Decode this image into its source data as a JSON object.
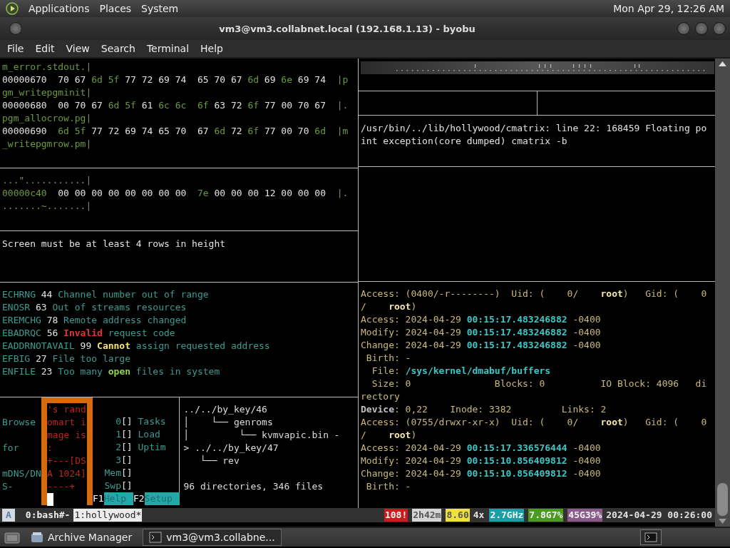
{
  "top_panel": {
    "menus": [
      "Applications",
      "Places",
      "System"
    ],
    "clock": "Mon Apr 29, 12:26 AM"
  },
  "window": {
    "title": "vm3@vm3.collabnet.local (192.168.1.13) - byobu"
  },
  "menu_bar": [
    "File",
    "Edit",
    "View",
    "Search",
    "Terminal",
    "Help"
  ],
  "terminal": {
    "left_column": [
      {
        "kind": "text",
        "lines": [
          {
            "segments": [
              {
                "kind": "hex",
                "text": "m_error.stdout."
              },
              {
                "kind": "dim",
                "text": "|"
              }
            ]
          },
          {
            "segments": [
              {
                "kind": "plain",
                "text": "00000670  70 67 "
              },
              {
                "kind": "hex",
                "text": "6d 5f"
              },
              {
                "kind": "plain",
                "text": " 77 72 69 74  65 70 67 "
              },
              {
                "kind": "hex",
                "text": "6d"
              },
              {
                "kind": "plain",
                "text": " 69 "
              },
              {
                "kind": "hex",
                "text": "6e"
              },
              {
                "kind": "plain",
                "text": " 69 74  "
              },
              {
                "kind": "dim",
                "text": "|"
              },
              {
                "kind": "hex",
                "text": "p"
              }
            ]
          },
          {
            "segments": [
              {
                "kind": "hex",
                "text": "gm_writepgminit"
              },
              {
                "kind": "dim",
                "text": "|"
              }
            ]
          },
          {
            "segments": [
              {
                "kind": "plain",
                "text": "00000680  00 70 67 "
              },
              {
                "kind": "hex",
                "text": "6d 5f"
              },
              {
                "kind": "plain",
                "text": " 61 "
              },
              {
                "kind": "hex",
                "text": "6c 6c  6f"
              },
              {
                "kind": "plain",
                "text": " 63 72 "
              },
              {
                "kind": "hex",
                "text": "6f"
              },
              {
                "kind": "plain",
                "text": " 77 00 70 67  "
              },
              {
                "kind": "dim",
                "text": "|."
              }
            ]
          },
          {
            "segments": [
              {
                "kind": "hex",
                "text": "pgm_allocrow.pg"
              },
              {
                "kind": "dim",
                "text": "|"
              }
            ]
          },
          {
            "segments": [
              {
                "kind": "plain",
                "text": "00000690  "
              },
              {
                "kind": "hex",
                "text": "6d 5f"
              },
              {
                "kind": "plain",
                "text": " 77 72 69 74 65 70  67 "
              },
              {
                "kind": "hex",
                "text": "6d"
              },
              {
                "kind": "plain",
                "text": " 72 "
              },
              {
                "kind": "hex",
                "text": "6f"
              },
              {
                "kind": "plain",
                "text": " 77 00 70 "
              },
              {
                "kind": "hex",
                "text": "6d"
              },
              {
                "kind": "dim",
                "text": "  |"
              },
              {
                "kind": "hex",
                "text": "m"
              }
            ]
          },
          {
            "segments": [
              {
                "kind": "hex",
                "text": "_writepgmrow.pm"
              },
              {
                "kind": "dim",
                "text": "|"
              }
            ]
          }
        ]
      },
      {
        "kind": "text",
        "lines": [
          {
            "segments": [
              {
                "kind": "dim",
                "text": "...\"...........|"
              }
            ]
          },
          {
            "segments": [
              {
                "kind": "hex",
                "text": "00000c40"
              },
              {
                "kind": "plain",
                "text": "  00 00 00 00 00 00 00 00  "
              },
              {
                "kind": "hex",
                "text": "7e"
              },
              {
                "kind": "plain",
                "text": " 00 00 00 12 00 00 00  "
              },
              {
                "kind": "dim",
                "text": "|."
              }
            ]
          },
          {
            "segments": [
              {
                "kind": "dim",
                "text": ".......~.......|"
              }
            ]
          }
        ]
      },
      {
        "kind": "text",
        "lines": [
          {
            "segments": [
              {
                "kind": "plain",
                "text": "Screen must be at least 4 rows in height"
              }
            ]
          }
        ]
      },
      {
        "kind": "text",
        "lines": [
          {
            "segments": [
              {
                "kind": "info",
                "text": "ECHRNG "
              },
              {
                "kind": "plain",
                "text": "44"
              },
              {
                "kind": "info",
                "text": " Channel number out of range"
              }
            ]
          },
          {
            "segments": [
              {
                "kind": "info",
                "text": "ENOSR "
              },
              {
                "kind": "plain",
                "text": "63"
              },
              {
                "kind": "info",
                "text": " Out of streams resources"
              }
            ]
          },
          {
            "segments": [
              {
                "kind": "info",
                "text": "EREMCHG "
              },
              {
                "kind": "plain",
                "text": "78"
              },
              {
                "kind": "info",
                "text": " Remote address changed"
              }
            ]
          },
          {
            "segments": [
              {
                "kind": "info",
                "text": "EBADRQC "
              },
              {
                "kind": "plain",
                "text": "56 "
              },
              {
                "kind": "alert",
                "text": "Invalid"
              },
              {
                "kind": "info",
                "text": " request code"
              }
            ]
          },
          {
            "segments": [
              {
                "kind": "info",
                "text": "EADDRNOTAVAIL "
              },
              {
                "kind": "plain",
                "text": "99 "
              },
              {
                "kind": "warn",
                "text": "Cannot"
              },
              {
                "kind": "info",
                "text": " assign requested address"
              }
            ]
          },
          {
            "segments": [
              {
                "kind": "info",
                "text": "EFBIG "
              },
              {
                "kind": "plain",
                "text": "27"
              },
              {
                "kind": "info",
                "text": " File too large"
              }
            ]
          },
          {
            "segments": [
              {
                "kind": "info",
                "text": "ENFILE "
              },
              {
                "kind": "plain",
                "text": "23"
              },
              {
                "kind": "info",
                "text": " Too many "
              },
              {
                "kind": "ok",
                "text": "open"
              },
              {
                "kind": "info",
                "text": " files in system"
              }
            ]
          }
        ]
      },
      {
        "kind": "split",
        "halves": [
          {
            "kind": "monitor",
            "rows": [
              {
                "box": "'s rand"
              },
              {
                "left": "Browse",
                "box": "omart i",
                "index": "0",
                "meter": "[]",
                "label": "Tasks"
              },
              {
                "box": "mage is",
                "index": "1",
                "meter": "[]",
                "label": "Load"
              },
              {
                "left": "for",
                "box": ":",
                "index": "2",
                "meter": "[]",
                "label": "Uptim"
              },
              {
                "box": "+---[DS",
                "index": "3",
                "meter": "[]"
              },
              {
                "left": "mDNS/DN",
                "box": "A 1024]",
                "index": "Mem",
                "meter": "[]"
              },
              {
                "left": "S-",
                "box": "----+",
                "index": "Swp",
                "meter": "[]"
              }
            ],
            "function_keys": [
              {
                "key": "F1",
                "label": "Help"
              },
              {
                "key": "F2",
                "label": "Setup"
              }
            ]
          },
          {
            "kind": "tree",
            "lines": [
              "../../by_key/46",
              "│    └── genroms",
              "│         └── kvmvapic.bin -",
              "> ../../by_key/47",
              "   └── rev"
            ],
            "summary": "96 directories, 346 files"
          }
        ]
      }
    ],
    "right_column": [
      {
        "kind": "matrix"
      },
      {
        "kind": "divided"
      },
      {
        "kind": "text",
        "lines": [
          {
            "segments": [
              {
                "kind": "plain",
                "text": "/usr/bin/../lib/hollywood/cmatrix: line 22: 168459 Floating po"
              }
            ]
          },
          {
            "segments": [
              {
                "kind": "plain",
                "text": "int exception(core dumped) cmatrix -b"
              }
            ]
          }
        ]
      },
      {
        "kind": "empty"
      },
      {
        "kind": "text",
        "lines": [
          {
            "segments": [
              {
                "kind": "stat",
                "text": "Access: (0400/-r--------)  Uid: (    0/    "
              },
              {
                "kind": "name",
                "text": "root"
              },
              {
                "kind": "stat",
                "text": ")   Gid: (    0"
              }
            ]
          },
          {
            "segments": [
              {
                "kind": "stat",
                "text": "/    "
              },
              {
                "kind": "name",
                "text": "root"
              },
              {
                "kind": "stat",
                "text": ")"
              }
            ]
          },
          {
            "segments": [
              {
                "kind": "stat",
                "text": "Access: 2024-04-29 "
              },
              {
                "kind": "time",
                "text": "00:15:17.483246882"
              },
              {
                "kind": "stat",
                "text": " -0400"
              }
            ]
          },
          {
            "segments": [
              {
                "kind": "stat",
                "text": "Modify: 2024-04-29 "
              },
              {
                "kind": "time",
                "text": "00:15:17.483246882"
              },
              {
                "kind": "stat",
                "text": " -0400"
              }
            ]
          },
          {
            "segments": [
              {
                "kind": "stat",
                "text": "Change: 2024-04-29 "
              },
              {
                "kind": "time",
                "text": "00:15:17.483246882"
              },
              {
                "kind": "stat",
                "text": " -0400"
              }
            ]
          },
          {
            "segments": [
              {
                "kind": "stat",
                "text": " Birth: -"
              }
            ]
          },
          {
            "segments": [
              {
                "kind": "stat",
                "text": "  File: "
              },
              {
                "kind": "time",
                "text": "/sys/kernel/dmabuf/buffers"
              }
            ]
          },
          {
            "segments": [
              {
                "kind": "stat",
                "text": "  Size: 0               Blocks: 0          IO Block: 4096   di"
              }
            ]
          },
          {
            "segments": [
              {
                "kind": "stat",
                "text": "rectory"
              }
            ]
          },
          {
            "segments": [
              {
                "kind": "device",
                "text": "Device"
              },
              {
                "kind": "stat",
                "text": ": 0,22    Inode: 3382         Links: 2"
              }
            ]
          },
          {
            "segments": [
              {
                "kind": "stat",
                "text": "Access: (0755/drwxr-xr-x)  Uid: (    0/    "
              },
              {
                "kind": "name",
                "text": "root"
              },
              {
                "kind": "stat",
                "text": ")   Gid: (    0"
              }
            ]
          },
          {
            "segments": [
              {
                "kind": "stat",
                "text": "/    "
              },
              {
                "kind": "name",
                "text": "root"
              },
              {
                "kind": "stat",
                "text": ")"
              }
            ]
          },
          {
            "segments": [
              {
                "kind": "stat",
                "text": "Access: 2024-04-29 "
              },
              {
                "kind": "time",
                "text": "00:15:17.336576444"
              },
              {
                "kind": "stat",
                "text": " -0400"
              }
            ]
          },
          {
            "segments": [
              {
                "kind": "stat",
                "text": "Modify: 2024-04-29 "
              },
              {
                "kind": "time",
                "text": "00:15:10.856409812"
              },
              {
                "kind": "stat",
                "text": " -0400"
              }
            ]
          },
          {
            "segments": [
              {
                "kind": "stat",
                "text": "Change: 2024-04-29 "
              },
              {
                "kind": "time",
                "text": "00:15:10.856409812"
              },
              {
                "kind": "stat",
                "text": " -0400"
              }
            ]
          },
          {
            "segments": [
              {
                "kind": "stat",
                "text": " Birth: -"
              }
            ]
          }
        ]
      }
    ]
  },
  "byobu_bar": {
    "logo": "A",
    "windows": [
      {
        "label": "0:bash#-",
        "selected": false
      },
      {
        "label": "1:hollywood*",
        "selected": true
      }
    ],
    "indicators": [
      {
        "text": "108!",
        "color": "#c41e1e"
      },
      {
        "text": "2h42m",
        "color": "#d6d6d6"
      },
      {
        "text": "8.60",
        "color": "#eee040"
      },
      {
        "text": "4x"
      },
      {
        "text": "2.7GHz",
        "color": "#1a9ea6"
      },
      {
        "text": "7.8G7%",
        "color": "#4c9a1e"
      },
      {
        "text": "45G39%",
        "color": "#8a5a8a"
      },
      {
        "text": "2024-04-29 00:26:00"
      }
    ]
  },
  "taskbar": {
    "tasks": [
      {
        "label": "Archive Manager",
        "selected": false
      },
      {
        "label": "vm3@vm3.collabne...",
        "selected": true
      }
    ]
  }
}
